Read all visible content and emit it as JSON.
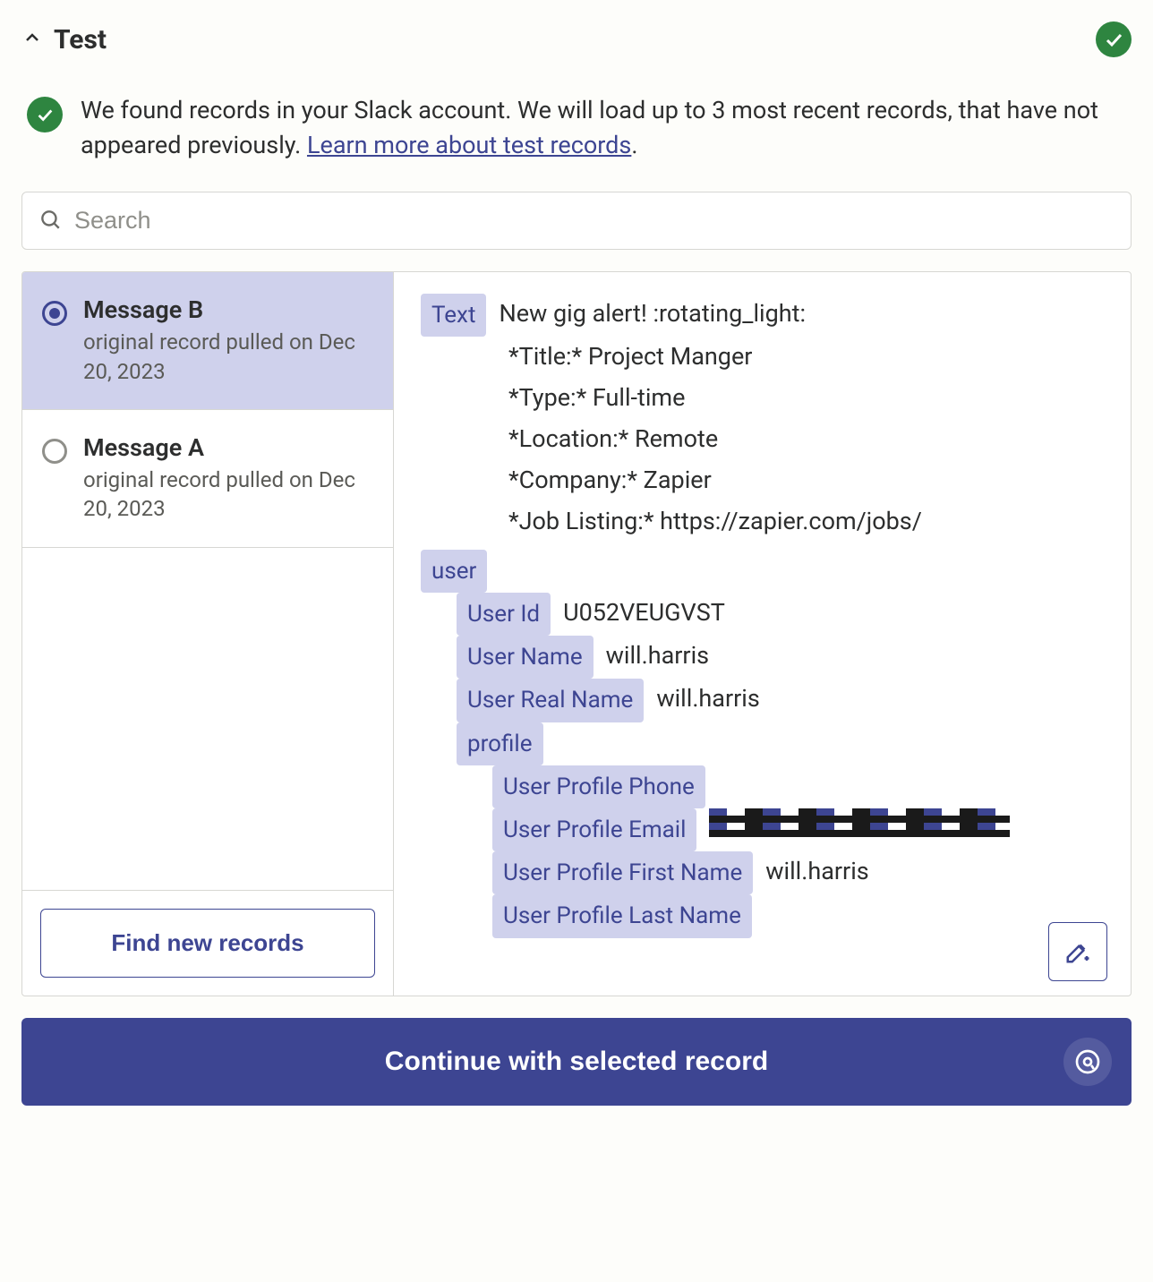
{
  "header": {
    "title": "Test"
  },
  "info": {
    "text_1": "We found records in your Slack account. We will load up to 3 most recent records, that have not appeared previously. ",
    "link_text": "Learn more about test records",
    "text_2": "."
  },
  "search": {
    "placeholder": "Search"
  },
  "records": {
    "items": [
      {
        "title": "Message B",
        "sub": "original record pulled on Dec 20, 2023",
        "selected": true
      },
      {
        "title": "Message A",
        "sub": "original record pulled on Dec 20, 2023",
        "selected": false
      }
    ],
    "find_button": "Find new records"
  },
  "detail": {
    "text_label": "Text",
    "text_line1": "New gig alert! :rotating_light:",
    "text_line2": "*Title:* Project Manger",
    "text_line3": "*Type:* Full-time",
    "text_line4": "*Location:* Remote",
    "text_line5": "*Company:* Zapier",
    "text_line6": "*Job Listing:* https://zapier.com/jobs/",
    "user_label": "user",
    "user_id_label": "User Id",
    "user_id_value": "U052VEUGVST",
    "user_name_label": "User Name",
    "user_name_value": "will.harris",
    "user_real_label": "User Real Name",
    "user_real_value": "will.harris",
    "profile_label": "profile",
    "phone_label": "User Profile Phone",
    "email_label": "User Profile Email",
    "fname_label": "User Profile First Name",
    "fname_value": "will.harris",
    "lname_label": "User Profile Last Name"
  },
  "footer": {
    "continue": "Continue with selected record"
  }
}
